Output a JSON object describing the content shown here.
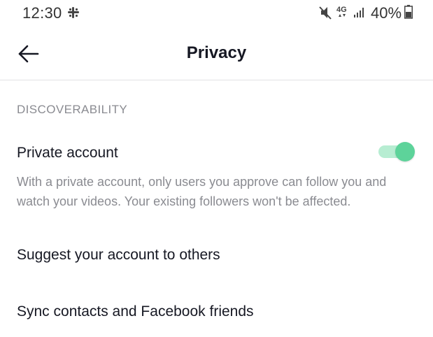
{
  "status_bar": {
    "time": "12:30",
    "network": "4G",
    "battery": "40%",
    "icons": [
      "slack-icon",
      "mute-icon",
      "network-4g-icon",
      "signal-icon",
      "battery-icon"
    ]
  },
  "header": {
    "title": "Privacy",
    "back_icon": "arrow-left-icon"
  },
  "discoverability": {
    "section_title": "DISCOVERABILITY",
    "private_account": {
      "label": "Private account",
      "description": "With a private account, only users you approve can follow you and watch your videos. Your existing followers won't be affected.",
      "enabled": true
    },
    "suggest_label": "Suggest your account to others",
    "sync_label": "Sync contacts and Facebook friends"
  },
  "colors": {
    "toggle_on_thumb": "#5dd39a",
    "toggle_on_track": "#b7edd2",
    "text_primary": "#161823",
    "text_secondary": "#8a8b91"
  }
}
